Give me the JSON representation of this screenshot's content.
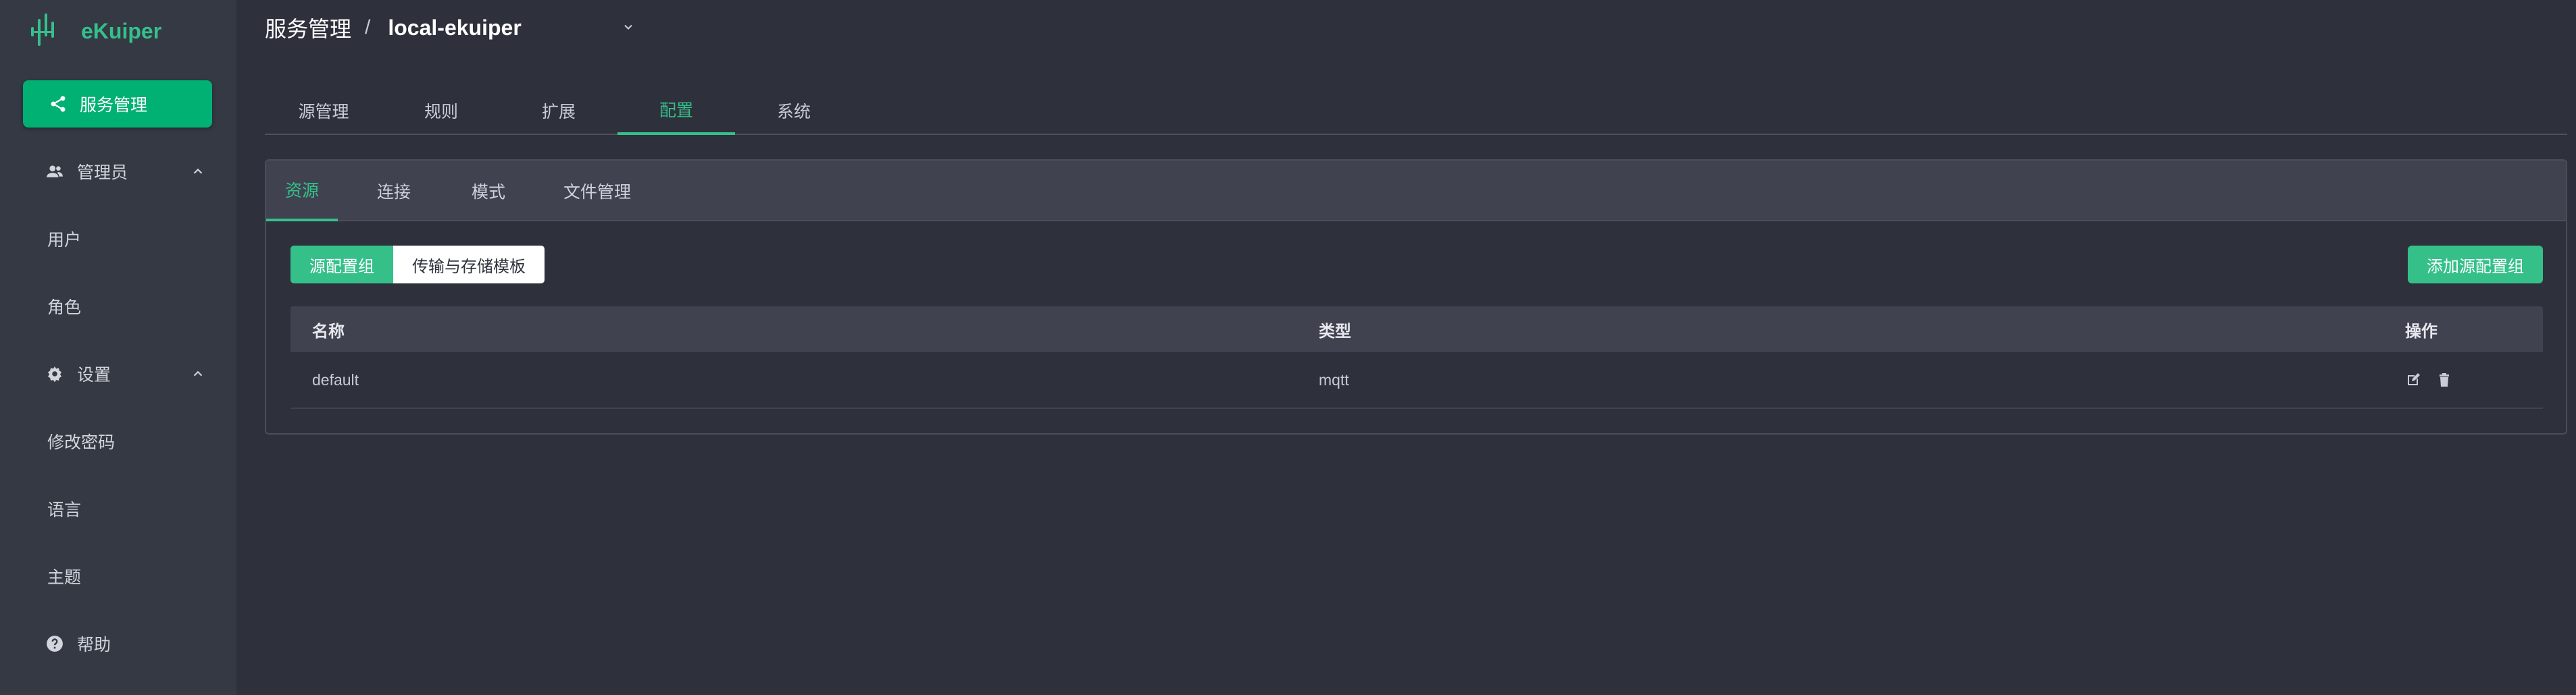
{
  "app": {
    "name": "eKuiper",
    "brand_color": "#35c08a"
  },
  "sidebar": {
    "active_item": {
      "label": "服务管理",
      "icon": "share-icon"
    },
    "items": [
      {
        "label": "管理员",
        "icon": "users-icon",
        "expanded": true
      },
      {
        "label": "用户"
      },
      {
        "label": "角色"
      },
      {
        "label": "设置",
        "icon": "gear-icon",
        "expanded": true
      },
      {
        "label": "修改密码"
      },
      {
        "label": "语言"
      },
      {
        "label": "主题"
      },
      {
        "label": "帮助",
        "icon": "help-icon"
      }
    ]
  },
  "header": {
    "breadcrumb_root": "服务管理",
    "separator": "/",
    "current_service": "local-ekuiper"
  },
  "main_tabs": [
    "源管理",
    "规则",
    "扩展",
    "配置",
    "系统"
  ],
  "main_tab_active": "配置",
  "config_tabs": [
    "资源",
    "连接",
    "模式",
    "文件管理"
  ],
  "config_tab_active": "资源",
  "segment": {
    "active": "源配置组",
    "inactive": "传输与存储模板"
  },
  "add_button": "添加源配置组",
  "table": {
    "columns": [
      "名称",
      "类型",
      "操作"
    ],
    "rows": [
      {
        "name": "default",
        "type": "mqtt",
        "actions": [
          "edit-icon",
          "delete-icon"
        ]
      }
    ]
  }
}
